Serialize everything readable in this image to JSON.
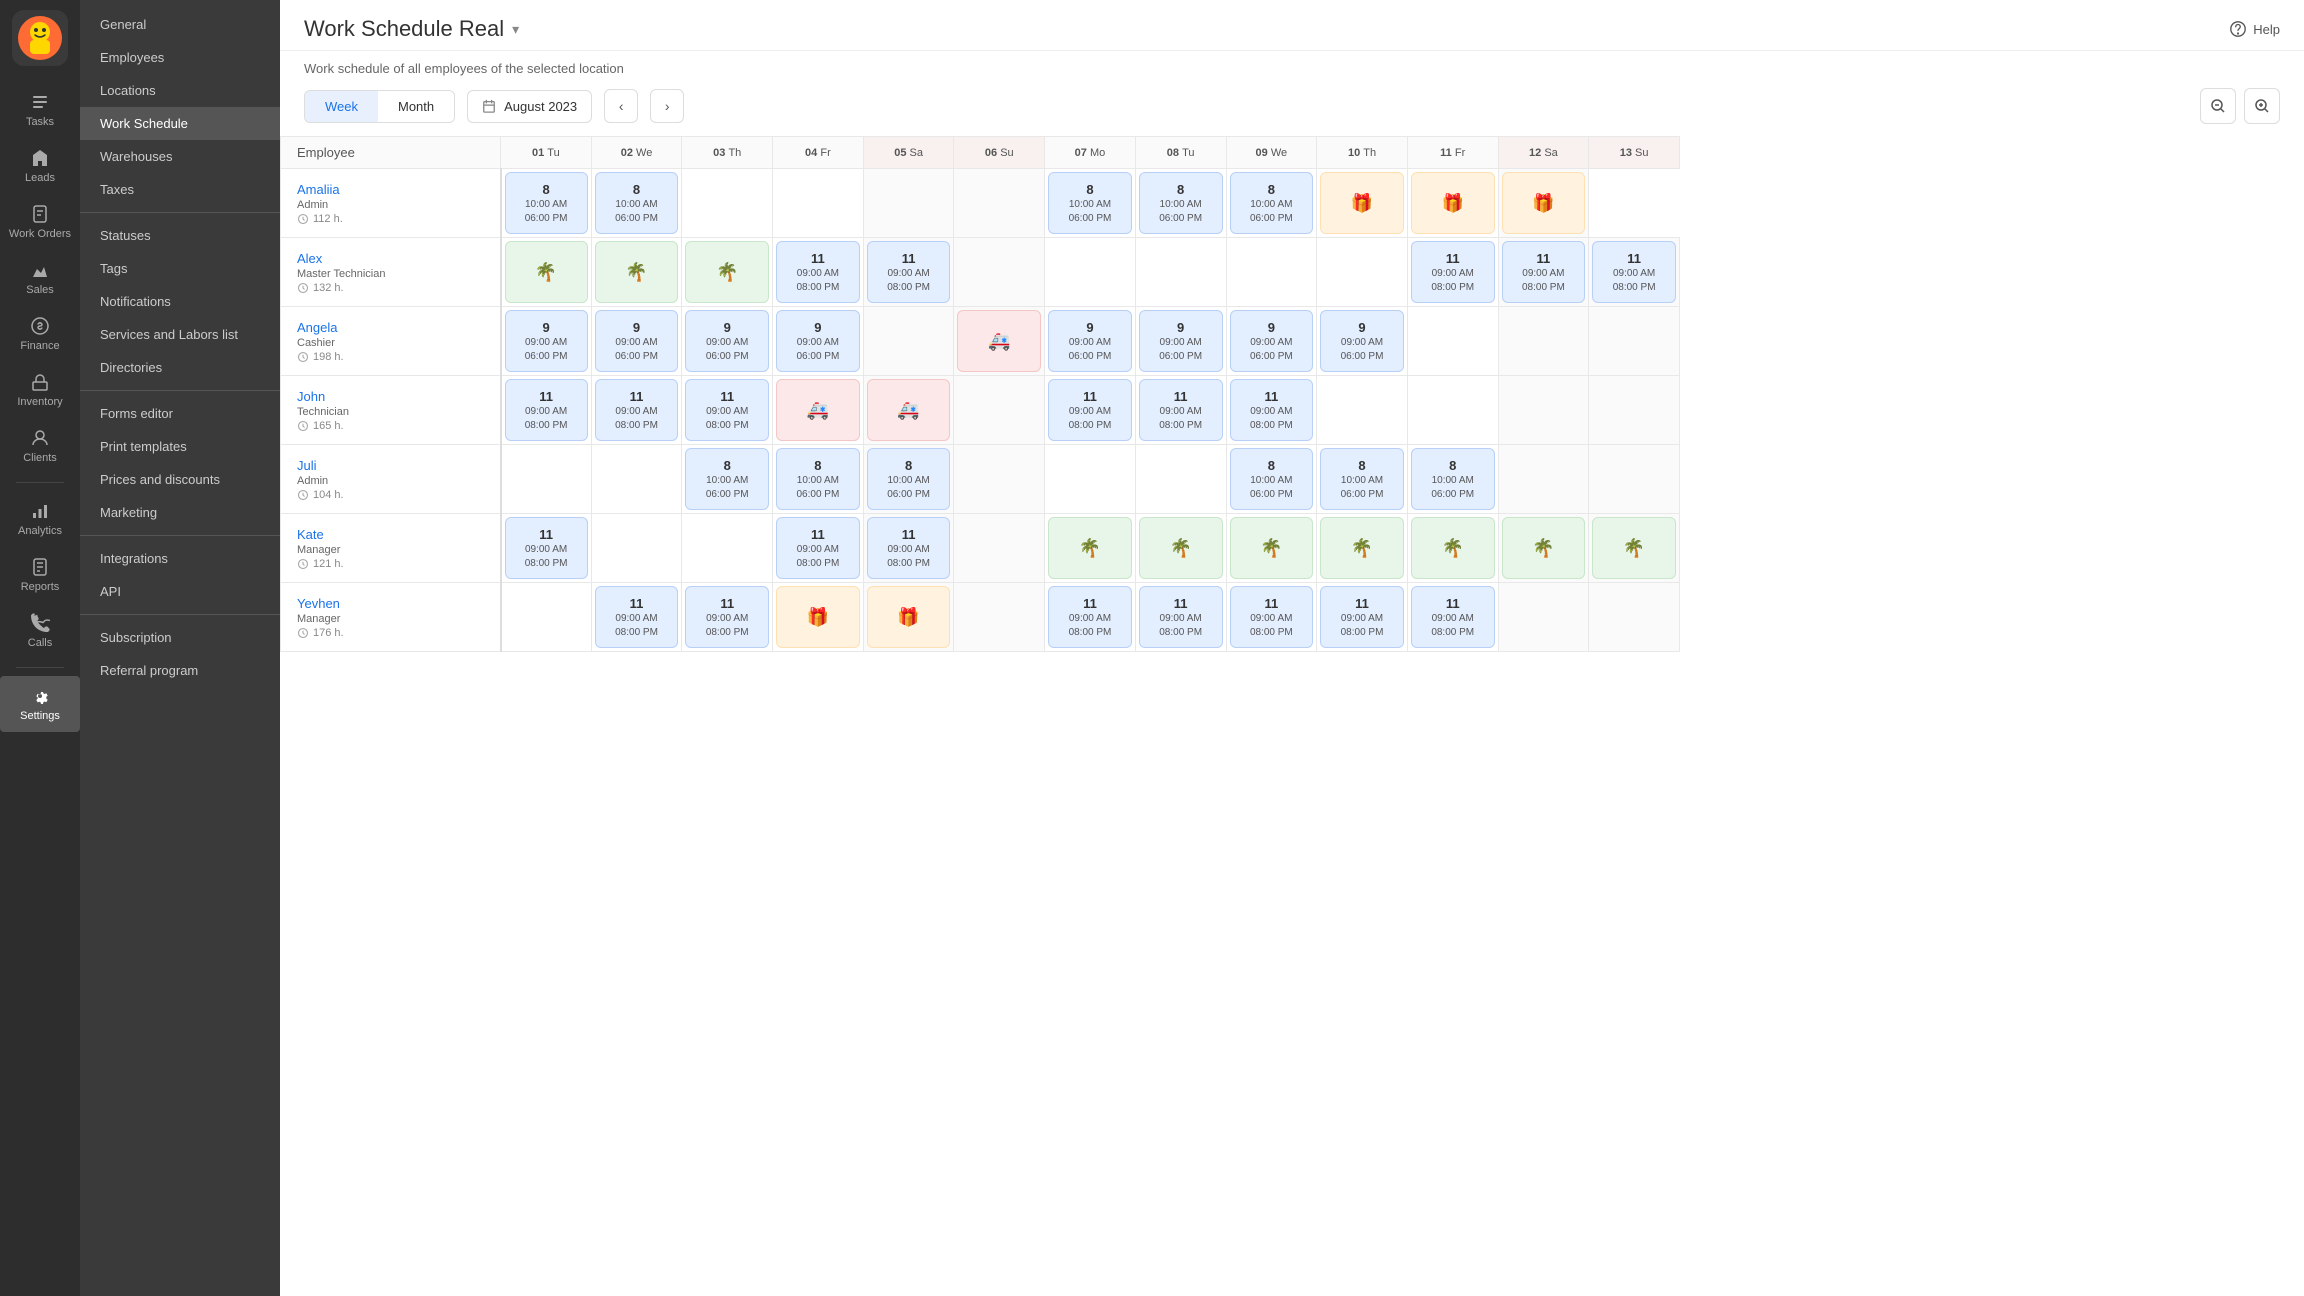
{
  "app": {
    "title": "Work Schedule Real",
    "title_dropdown": "▾",
    "subtitle": "Work schedule of all employees of the selected location",
    "help_label": "Help"
  },
  "nav": {
    "items": [
      {
        "id": "tasks",
        "label": "Tasks",
        "icon": "tasks"
      },
      {
        "id": "leads",
        "label": "Leads",
        "icon": "leads"
      },
      {
        "id": "work-orders",
        "label": "Work Orders",
        "icon": "work-orders"
      },
      {
        "id": "sales",
        "label": "Sales",
        "icon": "sales"
      },
      {
        "id": "finance",
        "label": "Finance",
        "icon": "finance"
      },
      {
        "id": "inventory",
        "label": "Inventory",
        "icon": "inventory"
      },
      {
        "id": "clients",
        "label": "Clients",
        "icon": "clients"
      },
      {
        "id": "analytics",
        "label": "Analytics",
        "icon": "analytics"
      },
      {
        "id": "reports",
        "label": "Reports",
        "icon": "reports"
      },
      {
        "id": "calls",
        "label": "Calls",
        "icon": "calls"
      },
      {
        "id": "settings",
        "label": "Settings",
        "icon": "settings",
        "active": true
      }
    ]
  },
  "submenu": {
    "items": [
      {
        "id": "general",
        "label": "General"
      },
      {
        "id": "employees",
        "label": "Employees"
      },
      {
        "id": "locations",
        "label": "Locations"
      },
      {
        "id": "work-schedule",
        "label": "Work Schedule",
        "active": true
      },
      {
        "id": "warehouses",
        "label": "Warehouses"
      },
      {
        "id": "taxes",
        "label": "Taxes"
      },
      {
        "id": "statuses",
        "label": "Statuses"
      },
      {
        "id": "tags",
        "label": "Tags"
      },
      {
        "id": "notifications",
        "label": "Notifications"
      },
      {
        "id": "services-labors",
        "label": "Services and Labors list"
      },
      {
        "id": "directories",
        "label": "Directories"
      },
      {
        "id": "forms-editor",
        "label": "Forms editor"
      },
      {
        "id": "print-templates",
        "label": "Print templates"
      },
      {
        "id": "prices-discounts",
        "label": "Prices and discounts"
      },
      {
        "id": "marketing",
        "label": "Marketing"
      },
      {
        "id": "integrations",
        "label": "Integrations"
      },
      {
        "id": "api",
        "label": "API"
      },
      {
        "id": "subscription",
        "label": "Subscription"
      },
      {
        "id": "referral",
        "label": "Referral program"
      }
    ]
  },
  "toolbar": {
    "view_week": "Week",
    "view_month": "Month",
    "current_date": "August 2023",
    "active_view": "week"
  },
  "schedule": {
    "columns": [
      {
        "label": "Employee",
        "is_employee": true
      },
      {
        "label": "01 Tu",
        "date": "01",
        "day": "Tu",
        "weekend": false
      },
      {
        "label": "02 We",
        "date": "02",
        "day": "We",
        "weekend": false
      },
      {
        "label": "03 Th",
        "date": "03",
        "day": "Th",
        "weekend": false
      },
      {
        "label": "04 Fr",
        "date": "04",
        "day": "Fr",
        "weekend": false
      },
      {
        "label": "05 Sa",
        "date": "05",
        "day": "Sa",
        "weekend": true
      },
      {
        "label": "06 Su",
        "date": "06",
        "day": "Su",
        "weekend": true
      },
      {
        "label": "07 Mo",
        "date": "07",
        "day": "Mo",
        "weekend": false
      },
      {
        "label": "08 Tu",
        "date": "08",
        "day": "Tu",
        "weekend": false
      },
      {
        "label": "09 We",
        "date": "09",
        "day": "We",
        "weekend": false
      },
      {
        "label": "10 Th",
        "date": "10",
        "day": "Th",
        "weekend": false
      },
      {
        "label": "11 Fr",
        "date": "11",
        "day": "Fr",
        "weekend": false
      },
      {
        "label": "12 Sa",
        "date": "12",
        "day": "Sa",
        "weekend": true
      },
      {
        "label": "13 Su",
        "date": "13",
        "day": "Su",
        "weekend": true
      }
    ],
    "employees": [
      {
        "name": "Amaliia",
        "role": "Admin",
        "hours": "112 h.",
        "shifts": [
          {
            "type": "blue",
            "hours": "8",
            "time1": "10:00 AM",
            "time2": "06:00 PM"
          },
          {
            "type": "blue",
            "hours": "8",
            "time1": "10:00 AM",
            "time2": "06:00 PM"
          },
          null,
          null,
          null,
          null,
          {
            "type": "blue",
            "hours": "8",
            "time1": "10:00 AM",
            "time2": "06:00 PM"
          },
          {
            "type": "blue",
            "hours": "8",
            "time1": "10:00 AM",
            "time2": "06:00 PM"
          },
          {
            "type": "blue",
            "hours": "8",
            "time1": "10:00 AM",
            "time2": "06:00 PM"
          },
          {
            "type": "orange",
            "icon": "gift"
          },
          {
            "type": "orange",
            "icon": "gift"
          },
          {
            "type": "orange",
            "icon": "gift"
          }
        ]
      },
      {
        "name": "Alex",
        "role": "Master Technician",
        "hours": "132 h.",
        "shifts": [
          {
            "type": "green",
            "icon": "palm"
          },
          {
            "type": "green",
            "icon": "palm"
          },
          {
            "type": "green",
            "icon": "palm"
          },
          {
            "type": "blue",
            "hours": "11",
            "time1": "09:00 AM",
            "time2": "08:00 PM"
          },
          {
            "type": "blue",
            "hours": "11",
            "time1": "09:00 AM",
            "time2": "08:00 PM"
          },
          null,
          null,
          null,
          null,
          null,
          {
            "type": "blue",
            "hours": "11",
            "time1": "09:00 AM",
            "time2": "08:00 PM"
          },
          {
            "type": "blue",
            "hours": "11",
            "time1": "09:00 AM",
            "time2": "08:00 PM"
          },
          {
            "type": "blue",
            "hours": "11",
            "time1": "09:00 AM",
            "time2": "08:00 PM"
          }
        ]
      },
      {
        "name": "Angela",
        "role": "Cashier",
        "hours": "198 h.",
        "shifts": [
          {
            "type": "blue",
            "hours": "9",
            "time1": "09:00 AM",
            "time2": "06:00 PM"
          },
          {
            "type": "blue",
            "hours": "9",
            "time1": "09:00 AM",
            "time2": "06:00 PM"
          },
          {
            "type": "blue",
            "hours": "9",
            "time1": "09:00 AM",
            "time2": "06:00 PM"
          },
          {
            "type": "blue",
            "hours": "9",
            "time1": "09:00 AM",
            "time2": "06:00 PM"
          },
          null,
          {
            "type": "red",
            "icon": "medical"
          },
          {
            "type": "blue",
            "hours": "9",
            "time1": "09:00 AM",
            "time2": "06:00 PM"
          },
          {
            "type": "blue",
            "hours": "9",
            "time1": "09:00 AM",
            "time2": "06:00 PM"
          },
          {
            "type": "blue",
            "hours": "9",
            "time1": "09:00 AM",
            "time2": "06:00 PM"
          },
          {
            "type": "blue",
            "hours": "9",
            "time1": "09:00 AM",
            "time2": "06:00 PM"
          },
          null,
          null,
          null
        ]
      },
      {
        "name": "John",
        "role": "Technician",
        "hours": "165 h.",
        "shifts": [
          {
            "type": "blue",
            "hours": "11",
            "time1": "09:00 AM",
            "time2": "08:00 PM"
          },
          {
            "type": "blue",
            "hours": "11",
            "time1": "09:00 AM",
            "time2": "08:00 PM"
          },
          {
            "type": "blue",
            "hours": "11",
            "time1": "09:00 AM",
            "time2": "08:00 PM"
          },
          {
            "type": "red",
            "icon": "medical"
          },
          {
            "type": "red",
            "icon": "medical"
          },
          null,
          {
            "type": "blue",
            "hours": "11",
            "time1": "09:00 AM",
            "time2": "08:00 PM"
          },
          {
            "type": "blue",
            "hours": "11",
            "time1": "09:00 AM",
            "time2": "08:00 PM"
          },
          {
            "type": "blue",
            "hours": "11",
            "time1": "09:00 AM",
            "time2": "08:00 PM"
          },
          null,
          null,
          null,
          null
        ]
      },
      {
        "name": "Juli",
        "role": "Admin",
        "hours": "104 h.",
        "shifts": [
          null,
          null,
          {
            "type": "blue",
            "hours": "8",
            "time1": "10:00 AM",
            "time2": "06:00 PM"
          },
          {
            "type": "blue",
            "hours": "8",
            "time1": "10:00 AM",
            "time2": "06:00 PM"
          },
          {
            "type": "blue",
            "hours": "8",
            "time1": "10:00 AM",
            "time2": "06:00 PM"
          },
          null,
          null,
          null,
          {
            "type": "blue",
            "hours": "8",
            "time1": "10:00 AM",
            "time2": "06:00 PM"
          },
          {
            "type": "blue",
            "hours": "8",
            "time1": "10:00 AM",
            "time2": "06:00 PM"
          },
          {
            "type": "blue",
            "hours": "8",
            "time1": "10:00 AM",
            "time2": "06:00 PM"
          },
          null,
          null
        ]
      },
      {
        "name": "Kate",
        "role": "Manager",
        "hours": "121 h.",
        "shifts": [
          {
            "type": "blue",
            "hours": "11",
            "time1": "09:00 AM",
            "time2": "08:00 PM"
          },
          null,
          null,
          {
            "type": "blue",
            "hours": "11",
            "time1": "09:00 AM",
            "time2": "08:00 PM"
          },
          {
            "type": "blue",
            "hours": "11",
            "time1": "09:00 AM",
            "time2": "08:00 PM"
          },
          null,
          {
            "type": "green",
            "icon": "palm"
          },
          {
            "type": "green",
            "icon": "palm"
          },
          {
            "type": "green",
            "icon": "palm"
          },
          {
            "type": "green",
            "icon": "palm"
          },
          {
            "type": "green",
            "icon": "palm"
          },
          {
            "type": "green",
            "icon": "palm"
          },
          {
            "type": "green",
            "icon": "palm"
          }
        ]
      },
      {
        "name": "Yevhen",
        "role": "Manager",
        "hours": "176 h.",
        "shifts": [
          null,
          {
            "type": "blue",
            "hours": "11",
            "time1": "09:00 AM",
            "time2": "08:00 PM"
          },
          {
            "type": "blue",
            "hours": "11",
            "time1": "09:00 AM",
            "time2": "08:00 PM"
          },
          {
            "type": "orange",
            "icon": "gift"
          },
          {
            "type": "orange",
            "icon": "gift"
          },
          null,
          {
            "type": "blue",
            "hours": "11",
            "time1": "09:00 AM",
            "time2": "08:00 PM"
          },
          {
            "type": "blue",
            "hours": "11",
            "time1": "09:00 AM",
            "time2": "08:00 PM"
          },
          {
            "type": "blue",
            "hours": "11",
            "time1": "09:00 AM",
            "time2": "08:00 PM"
          },
          {
            "type": "blue",
            "hours": "11",
            "time1": "09:00 AM",
            "time2": "08:00 PM"
          },
          {
            "type": "blue",
            "hours": "11",
            "time1": "09:00 AM",
            "time2": "08:00 PM"
          },
          null,
          null
        ]
      }
    ]
  }
}
